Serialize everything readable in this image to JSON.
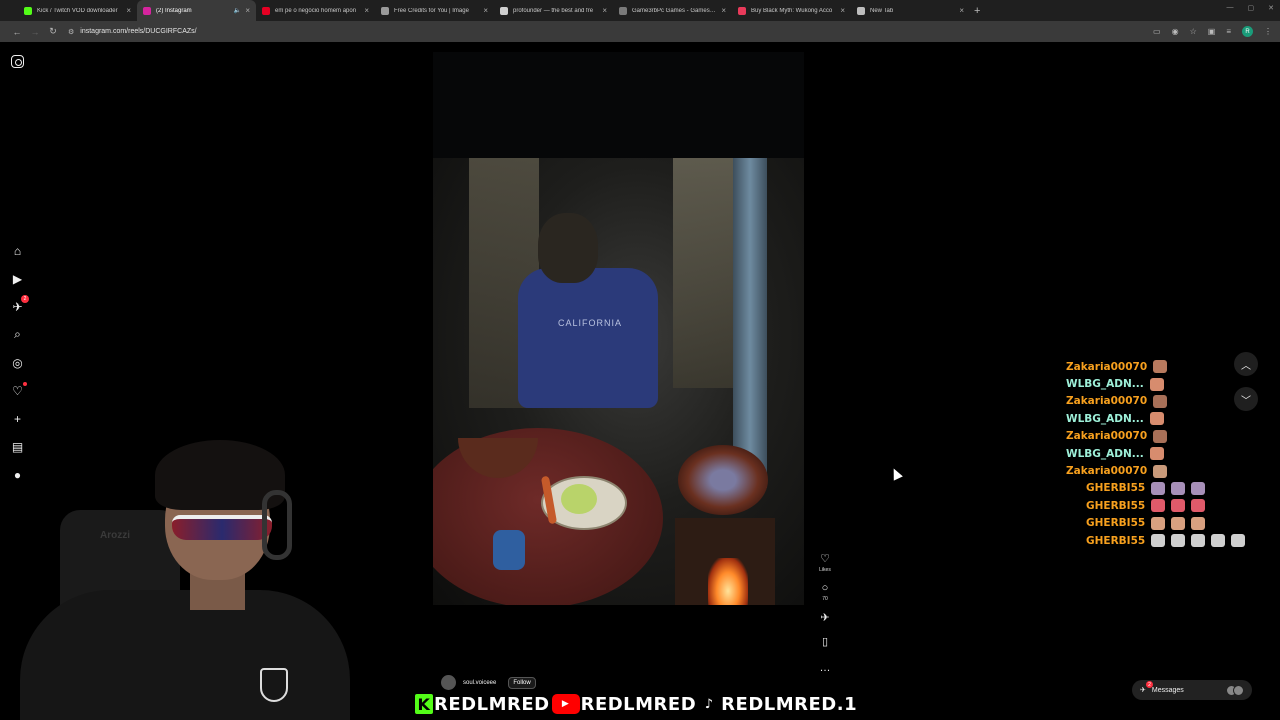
{
  "browser": {
    "tabs": [
      {
        "label": "Kick / Twitch VOD downloader",
        "favicon_color": "#53fc18",
        "active": false
      },
      {
        "label": "(2) Instagram",
        "favicon_color": "#d6249f",
        "active": true,
        "muted": true
      },
      {
        "label": "em pé o negócio homem apon",
        "favicon_color": "#e60023",
        "active": false
      },
      {
        "label": "Free Credits for You | Image ",
        "favicon_color": "#9a9a9a",
        "active": false
      },
      {
        "label": "profounder — the best and fre",
        "favicon_color": "#cfcfcf",
        "active": false
      },
      {
        "label": "Game3rbPc Games - Games Do",
        "favicon_color": "#7a7a7a",
        "active": false
      },
      {
        "label": "Buy Black Myth: Wukong Acco",
        "favicon_color": "#e83a5a",
        "active": false
      },
      {
        "label": "New Tab",
        "favicon_color": "#bdbdbd",
        "active": false
      }
    ],
    "new_tab_symbol": "+",
    "url": "instagram.com/reels/DUCGIRFCAZs/",
    "profile_initial": "R"
  },
  "reel": {
    "author": "soul.voiceee",
    "follow_label": "Follow",
    "hoodie_text": "CALIFORNIA",
    "likes_label": "Likes",
    "comments_count": "70"
  },
  "chat": [
    {
      "name": "Zakaria00070",
      "color": "#f7a01e",
      "emotes": [
        "#b87a5e"
      ]
    },
    {
      "name": "WLBG_ADN...",
      "color": "#9ef0d9",
      "emotes": [
        "#d78c6e"
      ]
    },
    {
      "name": "Zakaria00070",
      "color": "#f7a01e",
      "emotes": [
        "#a87058"
      ]
    },
    {
      "name": "WLBG_ADN...",
      "color": "#9ef0d9",
      "emotes": [
        "#d78c6e"
      ]
    },
    {
      "name": "Zakaria00070",
      "color": "#f7a01e",
      "emotes": [
        "#a87058"
      ]
    },
    {
      "name": "WLBG_ADN...",
      "color": "#9ef0d9",
      "emotes": [
        "#d78c6e"
      ]
    },
    {
      "name": "Zakaria00070",
      "color": "#f7a01e",
      "emotes": [
        "#c99a7a"
      ]
    },
    {
      "name": "GHERBI55",
      "color": "#f7a01e",
      "emotes": [
        "#a78fb8",
        "#a78fb8",
        "#a78fb8"
      ]
    },
    {
      "name": "GHERBI55",
      "color": "#f7a01e",
      "emotes": [
        "#e05a6a",
        "#e05a6a",
        "#e05a6a"
      ]
    },
    {
      "name": "GHERBI55",
      "color": "#f7a01e",
      "emotes": [
        "#d8a080",
        "#d8a080",
        "#d8a080"
      ]
    },
    {
      "name": "GHERBI55",
      "color": "#f7a01e",
      "emotes": [
        "#cfcfcf",
        "#cfcfcf",
        "#cfcfcf",
        "#cfcfcf",
        "#cfcfcf"
      ]
    }
  ],
  "messages": {
    "label": "Messages",
    "badge": "2"
  },
  "sidebar": {
    "notifications_badge": "2"
  },
  "webcam": {
    "chair_brand": "Arozzi"
  },
  "banner": {
    "kick_name": "REDLMRED",
    "youtube_name": "REDLMRED",
    "tiktok_name": "REDLMRED.1"
  }
}
